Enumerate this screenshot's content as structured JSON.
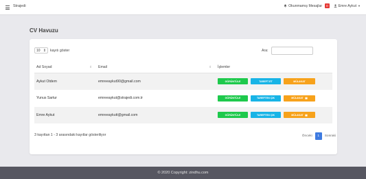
{
  "navbar": {
    "brand": "Strajedi",
    "messages_label": "Okunmamış Mesajlar",
    "messages_count": "0",
    "user_name": "Emre Aykut"
  },
  "page": {
    "title": "CV Havuzu"
  },
  "table_controls": {
    "length_value": "10",
    "length_suffix": "kayıtı göster",
    "search_label": "Ara:",
    "search_value": ""
  },
  "table": {
    "headers": [
      "Ad Soyad",
      "Email",
      "İşlemler"
    ],
    "rows": [
      {
        "name": "Aykut Otdem",
        "email": "emreeaykut90@gmail.com"
      },
      {
        "name": "Yunus Sartur",
        "email": "emreeaykut@strajedi.com.tr"
      },
      {
        "name": "Emre Aykut",
        "email": "emreeaykutt@gmail.com"
      }
    ],
    "action_labels": {
      "view": "GÖRÜNTÜLE",
      "redirect": "TAREFT ET",
      "redirect_alt": "TAREFTEN ÇIK",
      "interview": "MÜLAKAT"
    }
  },
  "info_text": "3 kayıttan 1 - 3 arasındaki kayıtlar gösteriliyor",
  "pagination": {
    "prev": "Önceki",
    "current": "1",
    "next": "Sonraki"
  },
  "footer": {
    "text": "© 2020 Copyright: zindhu.com"
  },
  "colors": {
    "view_button": "#1ec94c",
    "redirect_button": "#18b4e6",
    "interview_button": "#f7a21b",
    "badge": "#e53935",
    "page_current": "#3f7be0",
    "footer_bg": "#575761"
  },
  "icons": {
    "menu": "hamburger-icon",
    "bell": "bell-icon",
    "user": "user-icon",
    "calendar": "calendar-icon"
  }
}
